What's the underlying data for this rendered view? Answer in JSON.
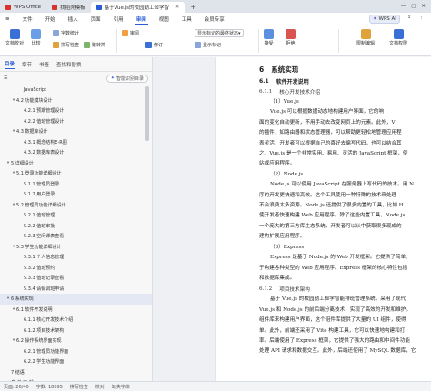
{
  "titlebar": {
    "tabs": [
      {
        "label": "WPS Office",
        "color": "#d9342b",
        "active": false
      },
      {
        "label": "找稻壳模板",
        "color": "#d9342b",
        "active": false
      },
      {
        "label": "基于Vue.js的校园勤工俭学智",
        "color": "#2a5cd7",
        "active": true
      }
    ],
    "wps_ai": "WPS AI"
  },
  "menubar": {
    "file": "文件",
    "items": [
      "开始",
      "插入",
      "页面",
      "引用",
      "审阅",
      "视图",
      "工具",
      "会员专享"
    ],
    "active": "审阅"
  },
  "toolbar": {
    "groups": {
      "doc_proof": "文档校对",
      "compare": "比较",
      "word_count": "字数统计",
      "spell": "拼写检查",
      "convert": "繁转简",
      "show_markup": "显示标记的最终状态",
      "show_markup2": "显示标记",
      "modify": "修订",
      "accept": "接受",
      "reject": "拒绝",
      "reviewers": "审阅",
      "restrict": "限制编辑",
      "protect": "文档权限"
    }
  },
  "nav": {
    "tabs": [
      "目录",
      "章节",
      "书签",
      "查找和替换"
    ],
    "active_tab": "目录",
    "smart_toc": "智能识别目录",
    "items": [
      {
        "label": "JavaScript",
        "level": 3,
        "arrow": false
      },
      {
        "label": "4.2  功能模块设计",
        "level": 2,
        "arrow": true
      },
      {
        "label": "4.2.1  预期管理设计",
        "level": 3,
        "arrow": false
      },
      {
        "label": "4.2.2  值班管理设计",
        "level": 3,
        "arrow": false
      },
      {
        "label": "4.3  数据库设计",
        "level": 2,
        "arrow": true
      },
      {
        "label": "4.3.1  概念结构E-R图",
        "level": 3,
        "arrow": false
      },
      {
        "label": "4.3.2  数据库表设计",
        "level": 3,
        "arrow": false
      },
      {
        "label": "5  详细设计",
        "level": 1,
        "arrow": true
      },
      {
        "label": "5.1  登录功能详细设计",
        "level": 2,
        "arrow": true
      },
      {
        "label": "5.1.1  管理员登录",
        "level": 3,
        "arrow": false
      },
      {
        "label": "5.1.2  用户登录",
        "level": 3,
        "arrow": false
      },
      {
        "label": "5.2  管理员功能详细设计",
        "level": 2,
        "arrow": true
      },
      {
        "label": "5.2.1  值班管理",
        "level": 3,
        "arrow": false
      },
      {
        "label": "5.2.2  值班审批",
        "level": 3,
        "arrow": false
      },
      {
        "label": "5.2.3  空闲课表查看",
        "level": 3,
        "arrow": false
      },
      {
        "label": "5.3  学生功能详细设计",
        "level": 2,
        "arrow": true
      },
      {
        "label": "5.3.1  个人信息管理",
        "level": 3,
        "arrow": false
      },
      {
        "label": "5.3.2  值班预约",
        "level": 3,
        "arrow": false
      },
      {
        "label": "5.3.3  值班记录查看",
        "level": 3,
        "arrow": false
      },
      {
        "label": "5.3.4  请假调班申请",
        "level": 3,
        "arrow": false
      },
      {
        "label": "6  系统实现",
        "level": 1,
        "arrow": true,
        "active": true
      },
      {
        "label": "6.1  软件开发说明",
        "level": 2,
        "arrow": true
      },
      {
        "label": "6.1.1  核心开发技术介绍",
        "level": 3,
        "arrow": false
      },
      {
        "label": "6.1.2  项目技术架构",
        "level": 3,
        "arrow": false
      },
      {
        "label": "6.2  操作系统界面实现",
        "level": 2,
        "arrow": true
      },
      {
        "label": "6.2.1  管理员功能界面",
        "level": 3,
        "arrow": false
      },
      {
        "label": "6.2.2  学生功能界面",
        "level": 3,
        "arrow": false
      },
      {
        "label": "7  结语",
        "level": 1,
        "arrow": false
      },
      {
        "label": "参  考  文  献",
        "level": 1,
        "arrow": false
      },
      {
        "label": "致  谢",
        "level": 1,
        "arrow": false
      }
    ]
  },
  "document": {
    "h1_num": "6",
    "h1_text": "系统实现",
    "h2_num": "6.1",
    "h2_text": "软件开发说明",
    "h3_num": "6.1.1",
    "h3_text": "核心开发技术介绍",
    "vue_title": "（1）Vue.js",
    "vue_lines": [
      "Vue.js 可以根据数据动态地构建用户界面，它的响",
      "面的变化自动更新，不用手动去改变网页上的元素。此外，V",
      "的插件，如路由器和状态管理器，可以帮助更轻松地管理应用程",
      "表灵活，开发者可以根据自己的喜好去编写代码，也可以结合其",
      "之，Vue.js 是一个非常实用、易用、灵活的 JavaScript 框架，使",
      "站或应用程序。"
    ],
    "node_title": "（2）Node.js",
    "node_lines": [
      "Node.js 可以使用 JavaScript 在服务器上写代码的技术。用 N",
      "序的开发更快速和高效。这个工具使用一种特殊的技术来处理",
      "不会浪费太多资源。Node.js 还提供了很多内置的工具，比如 H",
      "使开发者快速构建 Web 应用程序。除了这些内置工具，Node.js",
      "一个庞大的第三方库生态系统，开发者可以从中获取很多现成的",
      "建构扩展应用程序。"
    ],
    "express_title": "（3）Express",
    "express_lines": [
      "Express 是基于 Node.js 的 Web 开发框架。它提供了简单、",
      "于构建各种类型的 Web 应用程序。Express 框架的核心特性包括",
      "和数据库集成。"
    ],
    "h3b_num": "6.1.2",
    "h3b_text": "项目技术架构",
    "arch_lines": [
      "基于 Vue.js 的校园勤工俭学智能排班管理系统，采用了现代",
      "Vue.js 和 Node.js 的前后端分离技术，实现了高效的开发和维护。",
      "组件库来构建用户界面，这个组件库提供了大量的 UI 组件，使得",
      "单。此外，前端还采用了 Vite 构建工具，它可以快速地构建和打",
      "率。后端使用了 Express 框架，它提供了强大的路由和中间件功能",
      "处理 API 请求和数据交互。此外，后端还使用了 MySQL 数据库，它"
    ]
  },
  "statusbar": {
    "page": "页面: 26/40",
    "words": "字数: 18095",
    "spell": "拼写检查",
    "proof": "校对",
    "missing_font": "缺失字体"
  }
}
